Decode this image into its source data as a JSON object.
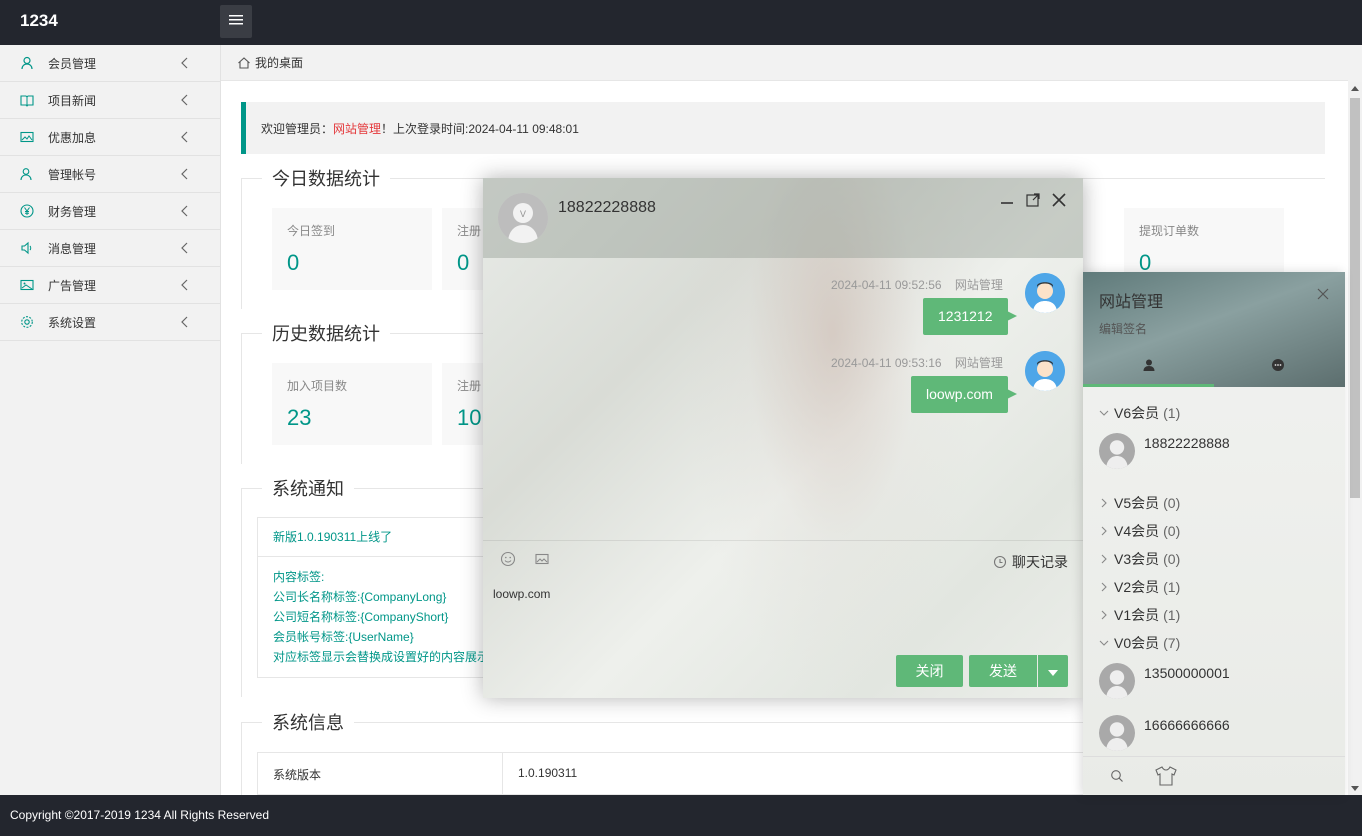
{
  "header": {
    "brand": "1234"
  },
  "sidebar": {
    "items": [
      {
        "label": "会员管理",
        "icon": "user-icon"
      },
      {
        "label": "项目新闻",
        "icon": "book-icon"
      },
      {
        "label": "优惠加息",
        "icon": "image-icon"
      },
      {
        "label": "管理帐号",
        "icon": "user-group-icon"
      },
      {
        "label": "财务管理",
        "icon": "yen-icon"
      },
      {
        "label": "消息管理",
        "icon": "speaker-icon"
      },
      {
        "label": "广告管理",
        "icon": "picture-icon"
      },
      {
        "label": "系统设置",
        "icon": "gear-icon"
      }
    ]
  },
  "breadcrumb": {
    "label": "我的桌面"
  },
  "welcome": {
    "prefix": "欢迎管理员：",
    "name": "网站管理",
    "suffix": "！上次登录时间:2024-04-11 09:48:01"
  },
  "today": {
    "legend": "今日数据统计",
    "cards": [
      {
        "label": "今日签到",
        "value": "0"
      },
      {
        "label": "注册",
        "value": "0"
      },
      {
        "label": "提现订单数",
        "value": "0"
      }
    ]
  },
  "history": {
    "legend": "历史数据统计",
    "cards": [
      {
        "label": "加入项目数",
        "value": "23"
      },
      {
        "label": "注册",
        "value": "10"
      }
    ]
  },
  "notice": {
    "legend": "系统通知",
    "title": "新版1.0.190311上线了",
    "lines": [
      "内容标签:",
      "公司长名称标签:{CompanyLong}",
      "公司短名称标签:{CompanyShort}",
      "会员帐号标签:{UserName}",
      "对应标签显示会替换成设置好的内容展示"
    ]
  },
  "sysinfo": {
    "legend": "系统信息",
    "key": "系统版本",
    "value": "1.0.190311"
  },
  "footer": {
    "copyright": "Copyright ©2017-2019 1234 All Rights Reserved"
  },
  "chat": {
    "contact": "18822228888",
    "messages": [
      {
        "time": "2024-04-11 09:52:56",
        "sender": "网站管理",
        "text": "1231212"
      },
      {
        "time": "2024-04-11 09:53:16",
        "sender": "网站管理",
        "text": "loowp.com"
      }
    ],
    "history_label": "聊天记录",
    "compose_text": "loowp.com",
    "close_label": "关闭",
    "send_label": "发送"
  },
  "panel": {
    "title": "网站管理",
    "signature": "编辑签名",
    "groups": [
      {
        "name": "V6会员",
        "count": "(1)",
        "expanded": true,
        "friends": [
          "18822228888"
        ]
      },
      {
        "name": "V5会员",
        "count": "(0)",
        "expanded": false
      },
      {
        "name": "V4会员",
        "count": "(0)",
        "expanded": false
      },
      {
        "name": "V3会员",
        "count": "(0)",
        "expanded": false
      },
      {
        "name": "V2会员",
        "count": "(1)",
        "expanded": false
      },
      {
        "name": "V1会员",
        "count": "(1)",
        "expanded": false
      },
      {
        "name": "V0会员",
        "count": "(7)",
        "expanded": true,
        "friends": [
          "13500000001",
          "16666666666"
        ]
      }
    ]
  },
  "colors": {
    "accent": "#009688",
    "green": "#5fb878",
    "header": "#23262e",
    "red": "#e4393c"
  }
}
